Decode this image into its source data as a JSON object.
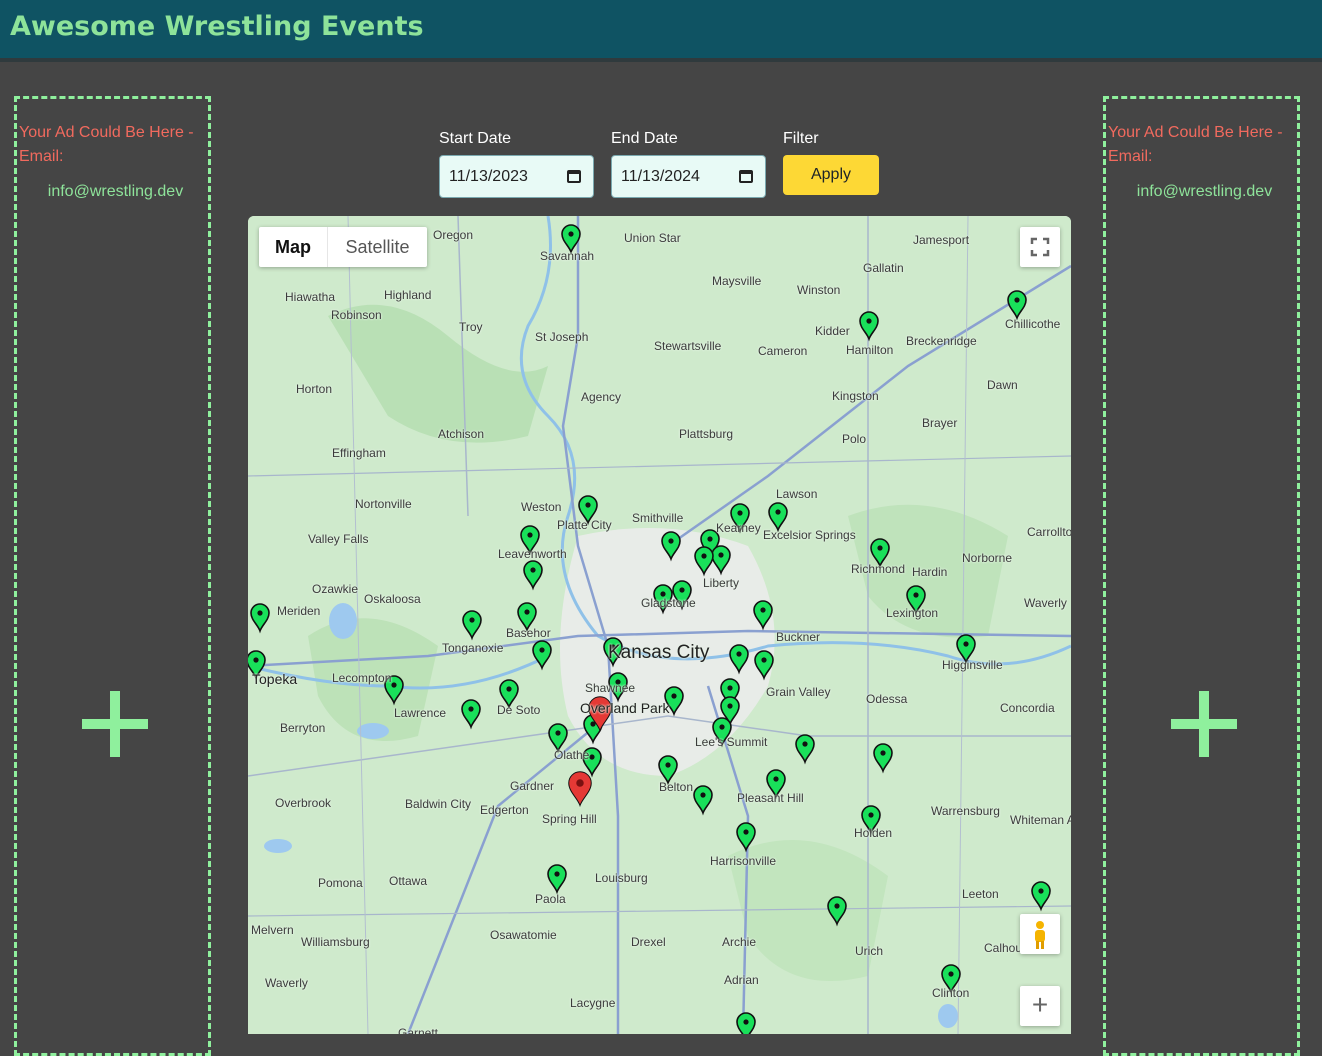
{
  "header": {
    "title": "Awesome Wrestling Events"
  },
  "ads": {
    "text": "Your Ad Could Be Here - Email:",
    "email": "info@wrestling.dev"
  },
  "filters": {
    "start_label": "Start Date",
    "start_value": "11/13/2023",
    "end_label": "End Date",
    "end_value": "11/13/2024",
    "filter_label": "Filter",
    "apply_label": "Apply"
  },
  "map": {
    "type_map": "Map",
    "type_satellite": "Satellite",
    "zoom_in": "+",
    "marker_colors": {
      "event": "#19e05a",
      "selected": "#e53935"
    },
    "cities": [
      "Oregon",
      "Savannah",
      "Union Star",
      "Jamesport",
      "Maysville",
      "Gallatin",
      "Hiawatha",
      "Highland",
      "Robinson",
      "Winston",
      "Troy",
      "St Joseph",
      "Kidder",
      "Hamilton",
      "Breckenridge",
      "Chillicothe",
      "Stewartsville",
      "Cameron",
      "Horton",
      "Agency",
      "Kingston",
      "Dawn",
      "Brayer",
      "Atchison",
      "Plattsburg",
      "Polo",
      "Effingham",
      "Lawson",
      "Nortonville",
      "Weston",
      "Platte City",
      "Smithville",
      "Kearney",
      "Excelsior Springs",
      "Carrollton",
      "Valley Falls",
      "Leavenworth",
      "Liberty",
      "Norborne",
      "Richmond",
      "Hardin",
      "Ozawkie",
      "Oskaloosa",
      "Meriden",
      "Gladstone",
      "Lexington",
      "Waverly",
      "Basehor",
      "Tonganoxie",
      "Kansas City",
      "Buckner",
      "Higginsville",
      "Lecompton",
      "Topeka",
      "Shawnee",
      "Grain Valley",
      "Odessa",
      "Concordia",
      "Lawrence",
      "De Soto",
      "Overland Park",
      "Berryton",
      "Olathe",
      "Lee's Summit",
      "Belton",
      "Gardner",
      "Pleasant Hill",
      "Overbrook",
      "Baldwin City",
      "Edgerton",
      "Warrensburg",
      "Spring Hill",
      "Holden",
      "Whiteman AFB",
      "Harrisonville",
      "Pomona",
      "Ottawa",
      "Louisburg",
      "Paola",
      "Leeton",
      "Melvern",
      "Williamsburg",
      "Osawatomie",
      "Drexel",
      "Archie",
      "Urich",
      "Calhoun",
      "Waverly",
      "Adrian",
      "Clinton",
      "Lacygne",
      "Garnett"
    ]
  }
}
